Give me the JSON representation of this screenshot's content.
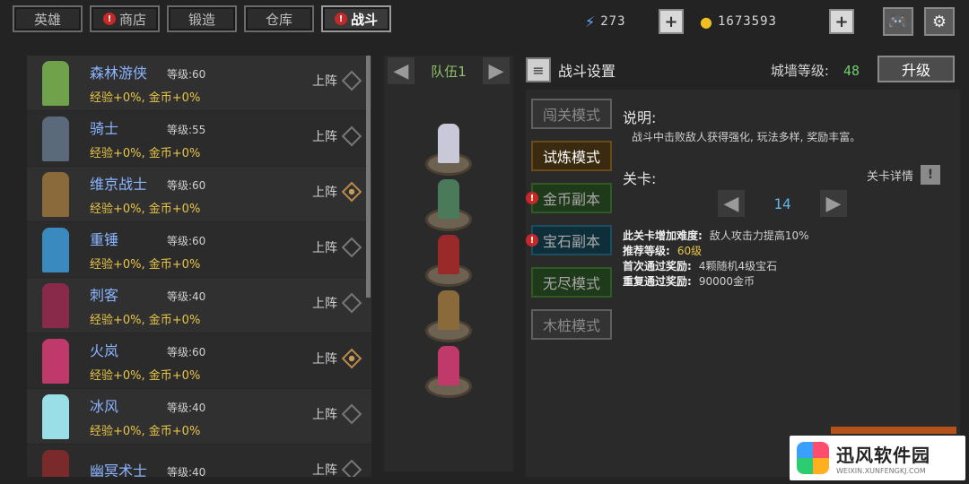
{
  "tabs": [
    {
      "label": "英雄",
      "alert": false,
      "active": false
    },
    {
      "label": "商店",
      "alert": true,
      "active": false
    },
    {
      "label": "锻造",
      "alert": false,
      "active": false
    },
    {
      "label": "仓库",
      "alert": false,
      "active": false
    },
    {
      "label": "战斗",
      "alert": true,
      "active": true
    }
  ],
  "resources": {
    "energy": {
      "icon": "lightning-icon",
      "value": "273"
    },
    "gold": {
      "icon": "coin-icon",
      "value": "1673593"
    }
  },
  "heroes": [
    {
      "name": "森林游侠",
      "level": "等级:60",
      "bonus": "经验+0%, 金币+0%",
      "deploy_label": "上阵",
      "deployed": false,
      "color": "#6fa24a"
    },
    {
      "name": "骑士",
      "level": "等级:55",
      "bonus": "经验+0%, 金币+0%",
      "deploy_label": "上阵",
      "deployed": false,
      "color": "#5a6a7a"
    },
    {
      "name": "维京战士",
      "level": "等级:60",
      "bonus": "经验+0%, 金币+0%",
      "deploy_label": "上阵",
      "deployed": true,
      "color": "#8a6a3a"
    },
    {
      "name": "重锤",
      "level": "等级:60",
      "bonus": "经验+0%, 金币+0%",
      "deploy_label": "上阵",
      "deployed": false,
      "color": "#3a8abf"
    },
    {
      "name": "刺客",
      "level": "等级:40",
      "bonus": "经验+0%, 金币+0%",
      "deploy_label": "上阵",
      "deployed": false,
      "color": "#8a2a4a"
    },
    {
      "name": "火岚",
      "level": "等级:60",
      "bonus": "经验+0%, 金币+0%",
      "deploy_label": "上阵",
      "deployed": true,
      "color": "#bf3a6a"
    },
    {
      "name": "冰风",
      "level": "等级:40",
      "bonus": "经验+0%, 金币+0%",
      "deploy_label": "上阵",
      "deployed": false,
      "color": "#9adfe8"
    },
    {
      "name": "幽冥术士",
      "level": "等级:40",
      "bonus": "",
      "deploy_label": "上阵",
      "deployed": false,
      "color": "#7a2a2a"
    }
  ],
  "team": {
    "title": "队伍1",
    "members": [
      {
        "color": "#c8c8d8"
      },
      {
        "color": "#4a7a5a"
      },
      {
        "color": "#9a2a2a"
      },
      {
        "color": "#8a6a3a"
      },
      {
        "color": "#bf3a6a"
      }
    ]
  },
  "settings": {
    "title": "战斗设置",
    "wall_label": "城墙等级:",
    "wall_level": "48",
    "upgrade_label": "升级",
    "modes": [
      {
        "label": "闯关模式",
        "style": "normal",
        "alert": false
      },
      {
        "label": "试炼模式",
        "style": "active",
        "alert": false
      },
      {
        "label": "金币副本",
        "style": "gold",
        "alert": true
      },
      {
        "label": "宝石副本",
        "style": "gem",
        "alert": true
      },
      {
        "label": "无尽模式",
        "style": "endless",
        "alert": false
      },
      {
        "label": "木桩模式",
        "style": "normal",
        "alert": false
      }
    ],
    "desc_title": "说明:",
    "desc_text": "战斗中击败敌人获得强化, 玩法多样, 奖励丰富。",
    "stage_title": "关卡:",
    "stage_detail": "关卡详情",
    "stage_number": "14",
    "info": [
      {
        "key": "此关卡增加难度:",
        "value": "敌人攻击力提高10%",
        "gold": false
      },
      {
        "key": "推荐等级:",
        "value": "60级",
        "gold": true
      },
      {
        "key": "首次通过奖励:",
        "value": "4颗随机4级宝石",
        "gold": false
      },
      {
        "key": "重复通过奖励:",
        "value": "90000金币",
        "gold": false
      }
    ]
  },
  "watermark": {
    "main": "迅风软件园",
    "sub": "WEIXIN.XUNFENGKJ.COM"
  }
}
